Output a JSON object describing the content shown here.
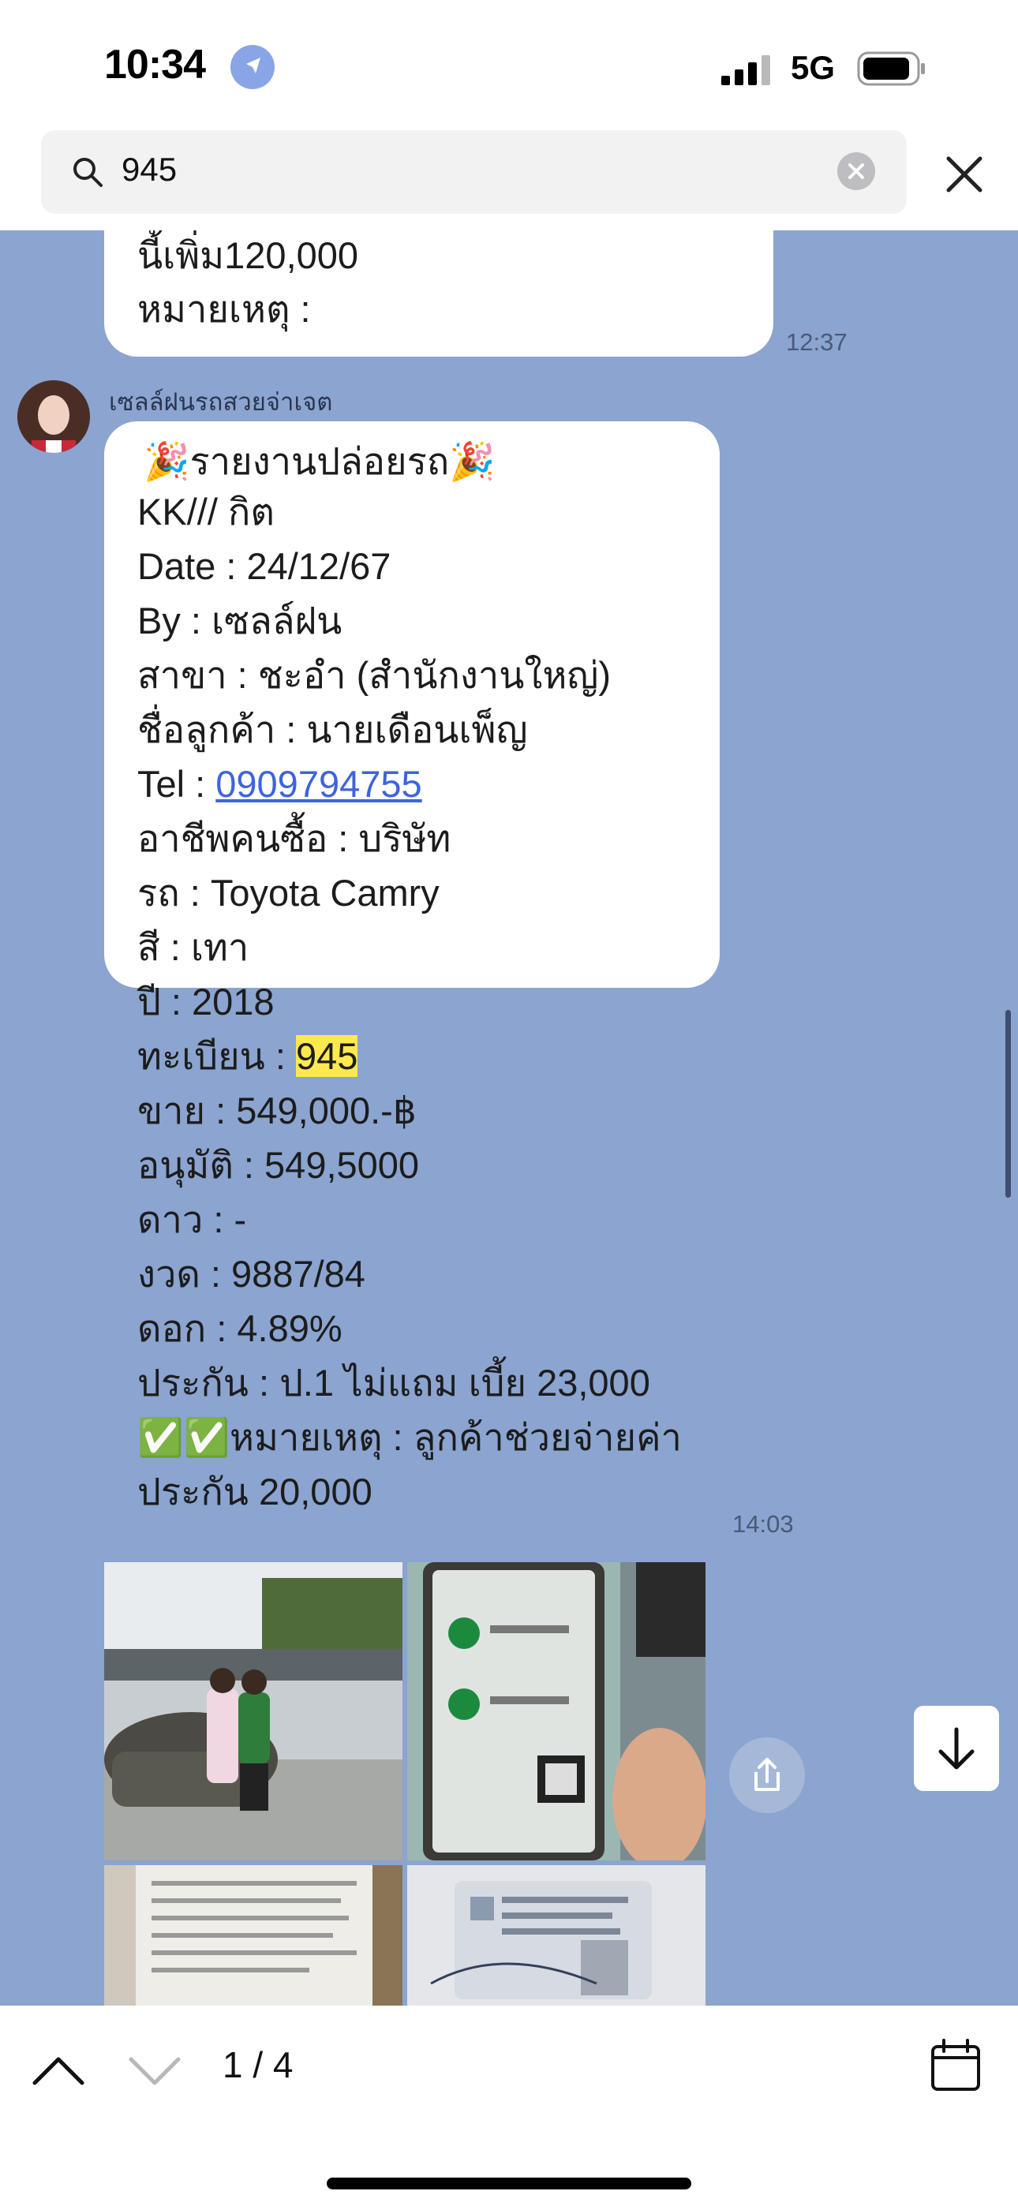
{
  "status_bar": {
    "time": "10:34",
    "network": "5G"
  },
  "search": {
    "query": "945"
  },
  "chat": {
    "prev_message": {
      "line_top": "นี้เพิ่ม120,000",
      "line_bottom": "หมายเหตุ :",
      "time": "12:37"
    },
    "sender_name": "เซลล์ฝนรถสวยจ่าเจต",
    "report": {
      "title": "🎉รายงานปล่อยรถ🎉",
      "line_kk": "KK/// กิต",
      "line_date": "Date : 24/12/67",
      "line_by": "By : เซลล์ฝน",
      "line_branch": "สาขา : ชะอำ (สำนักงานใหญ่)",
      "line_customer": "ชื่อลูกค้า : นายเดือนเพ็ญ",
      "tel_label": "Tel : ",
      "tel_number": "0909794755",
      "line_career": "อาชีพคนซื้อ : บริษัท",
      "line_car": "รถ : Toyota Camry",
      "line_color": "สี :  เทา",
      "line_year": "ปี : 2018",
      "plate_label": "ทะเบียน : ",
      "plate_value": "945",
      "line_sell": "ขาย : 549,000.-฿",
      "line_approve": "อนุมัติ : 549,5000",
      "line_down": "ดาว : -",
      "line_installment": "งวด : 9887/84",
      "line_interest": "ดอก : 4.89%",
      "line_insurance": "ประกัน : ป.1 ไม่แถม เบี้ย 23,000",
      "line_note": "✅✅หมายเหตุ : ลูกค้าช่วยจ่ายค่า",
      "line_note2": "ประกัน 20,000",
      "time": "14:03"
    }
  },
  "bottom": {
    "counter": "1 / 4"
  }
}
